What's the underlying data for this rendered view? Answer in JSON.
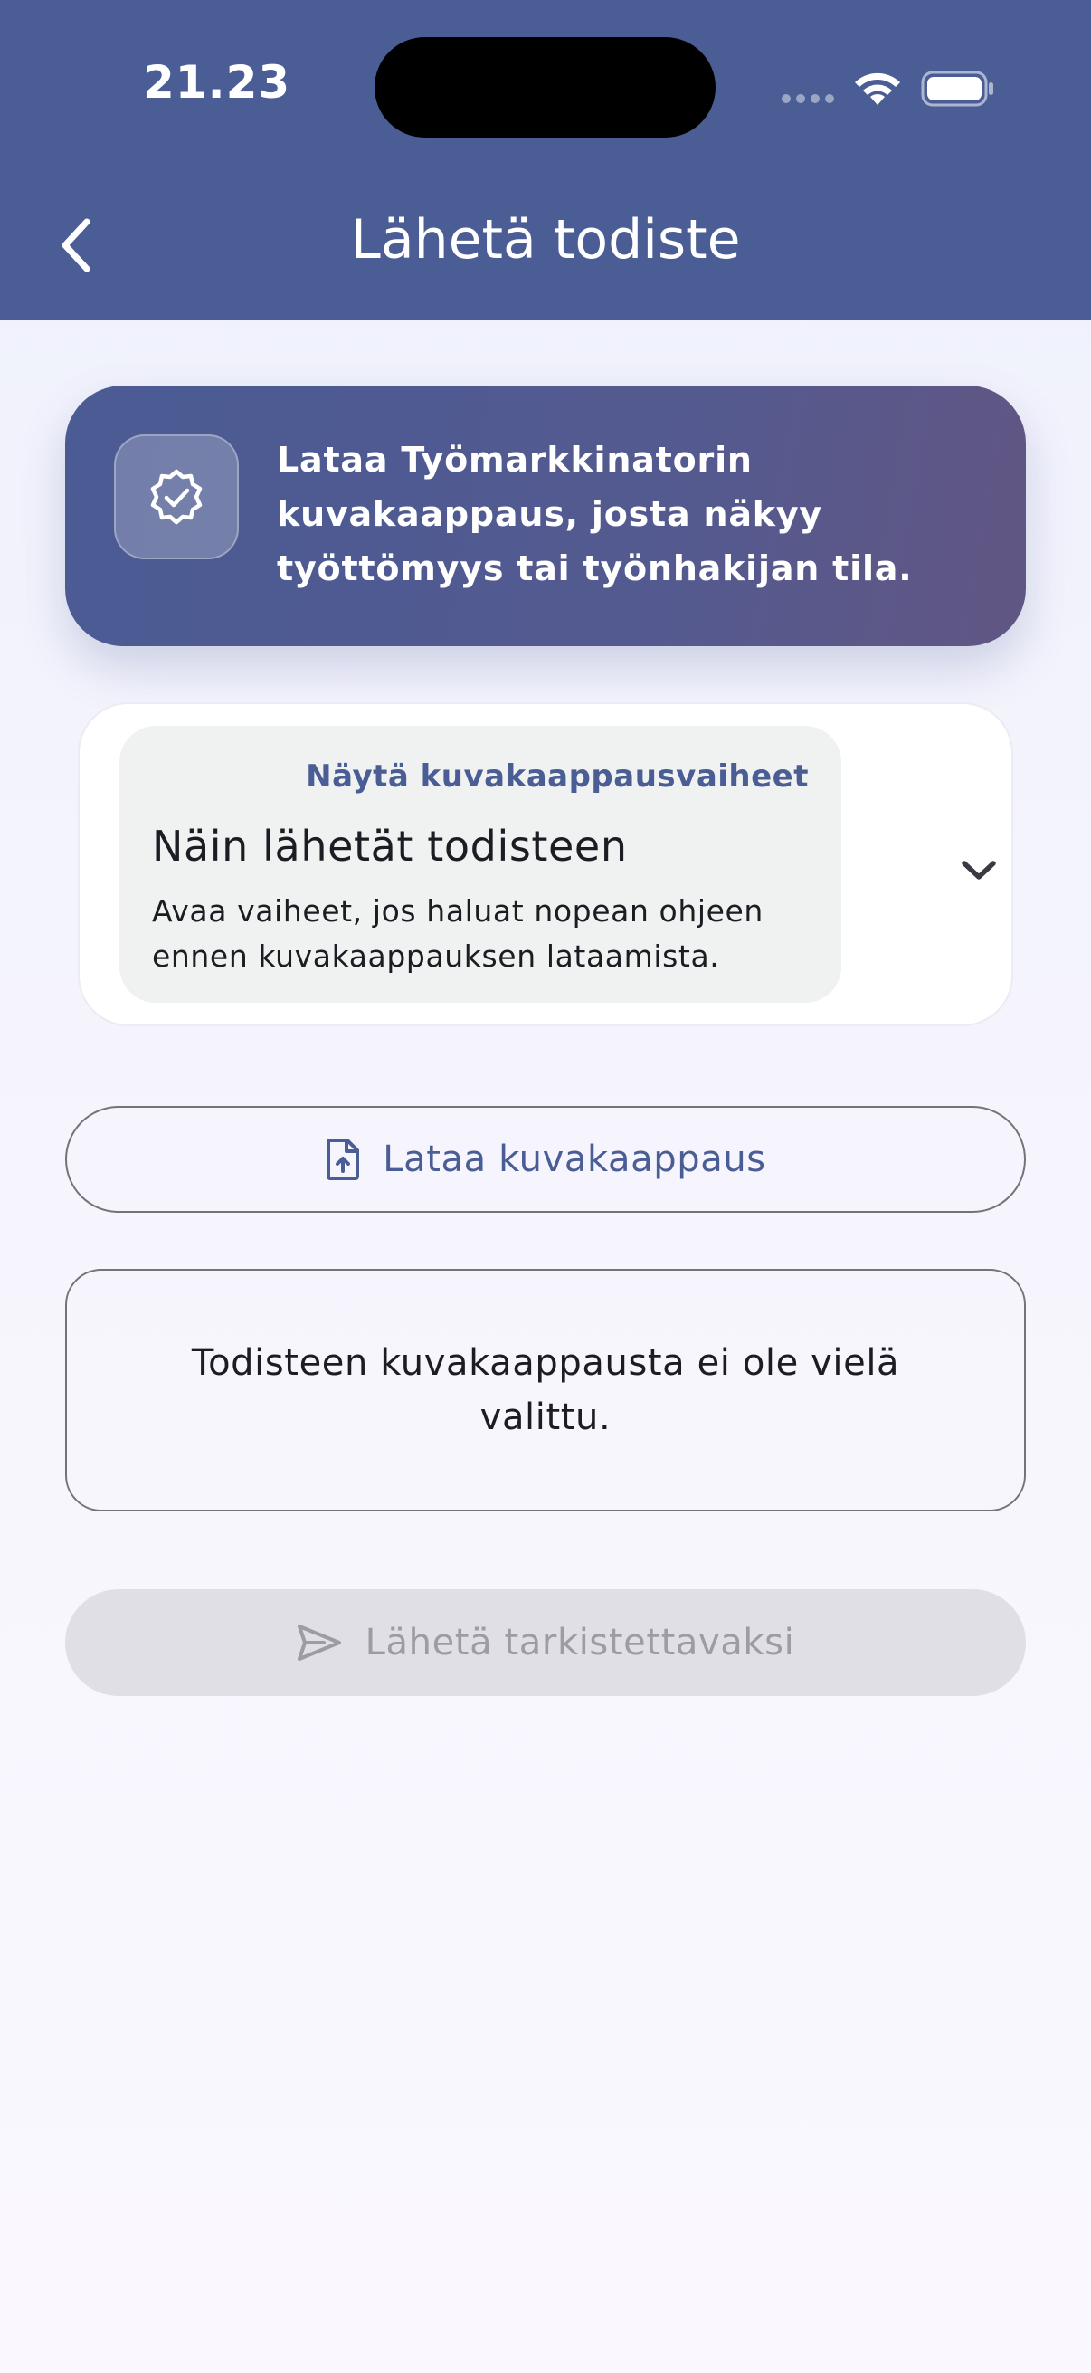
{
  "status_bar": {
    "time": "21.23",
    "icons": [
      "signal-icon",
      "wifi-icon",
      "battery-icon"
    ]
  },
  "header": {
    "back_icon": "chevron-left-icon",
    "title": "Lähetä todiste"
  },
  "info_banner": {
    "icon": "verified-badge-icon",
    "text": "Lataa Työmarkkinatorin kuvakaappaus, josta näkyy työttömyys tai työnhakijan tila."
  },
  "steps_card": {
    "toggle_label": "Näytä kuvakaappausvaiheet",
    "heading": "Näin lähetät todisteen",
    "description": "Avaa vaiheet, jos haluat nopean ohjeen ennen kuvakaappauksen lataamista.",
    "expand_icon": "chevron-down-icon"
  },
  "upload_button": {
    "icon": "file-upload-icon",
    "label": "Lataa kuvakaappaus"
  },
  "selection_status": {
    "text": "Todisteen kuvakaappausta ei ole vielä valittu."
  },
  "submit_button": {
    "icon": "send-icon",
    "label": "Lähetä tarkistettavaksi",
    "enabled": false
  },
  "colors": {
    "primary": "#4a5d94",
    "banner_end": "#615683",
    "outline": "#74737a",
    "disabled_bg": "#e0dfe5",
    "disabled_text": "#9d9ca2"
  }
}
